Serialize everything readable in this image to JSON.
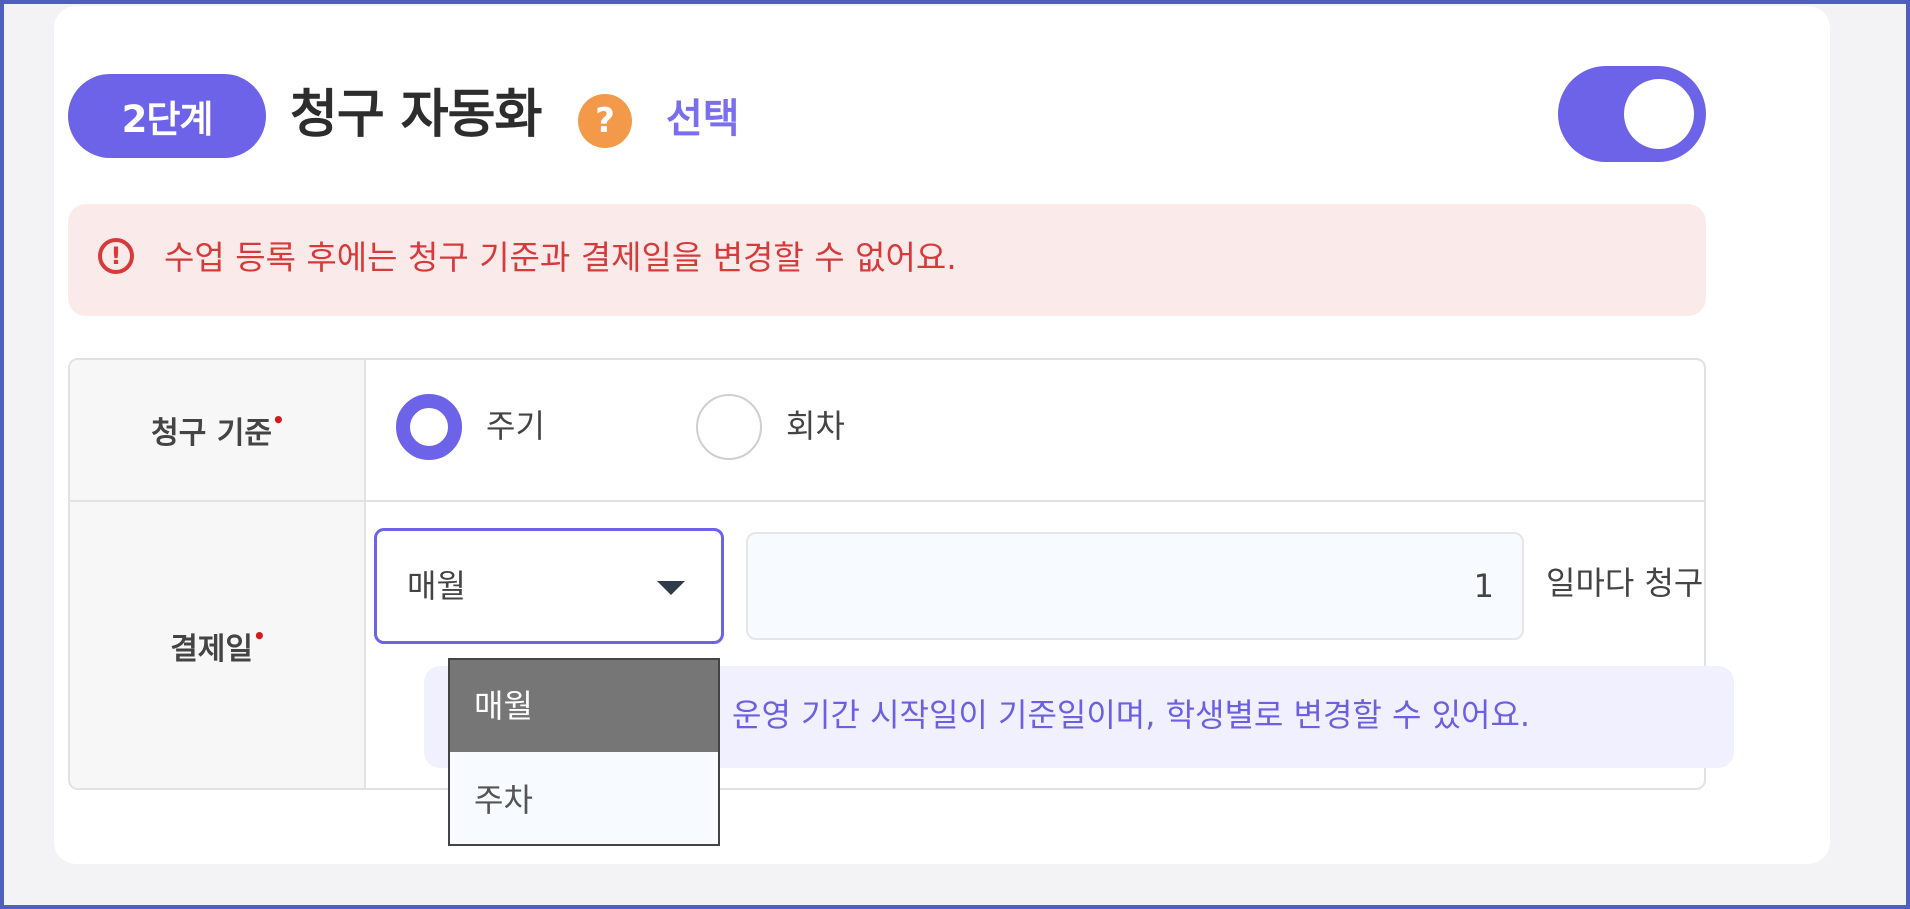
{
  "header": {
    "step_badge": "2단계",
    "title": "청구 자동화",
    "help_symbol": "?",
    "optional_label": "선택",
    "toggle_on": true
  },
  "warning": {
    "icon": "info-icon",
    "text": "수업 등록 후에는 청구 기준과 결제일을 변경할 수 없어요."
  },
  "billing_basis": {
    "label": "청구 기준",
    "required_mark": "•",
    "options": [
      {
        "label": "주기",
        "selected": true
      },
      {
        "label": "회차",
        "selected": false
      }
    ]
  },
  "payment_day": {
    "label": "결제일",
    "required_mark": "•",
    "period_select": {
      "value": "매월",
      "options": [
        "매월",
        "주차"
      ],
      "open": true,
      "highlighted": "매월"
    },
    "day_value": "1",
    "suffix": "일마다 청구",
    "info_text": "운영 기간 시작일이 기준일이며, 학생별로 변경할 수 있어요."
  },
  "colors": {
    "accent": "#6c63e9",
    "warning_bg": "#fbeaea",
    "warning_text": "#d63b3b",
    "help_orange": "#f39a4a"
  }
}
